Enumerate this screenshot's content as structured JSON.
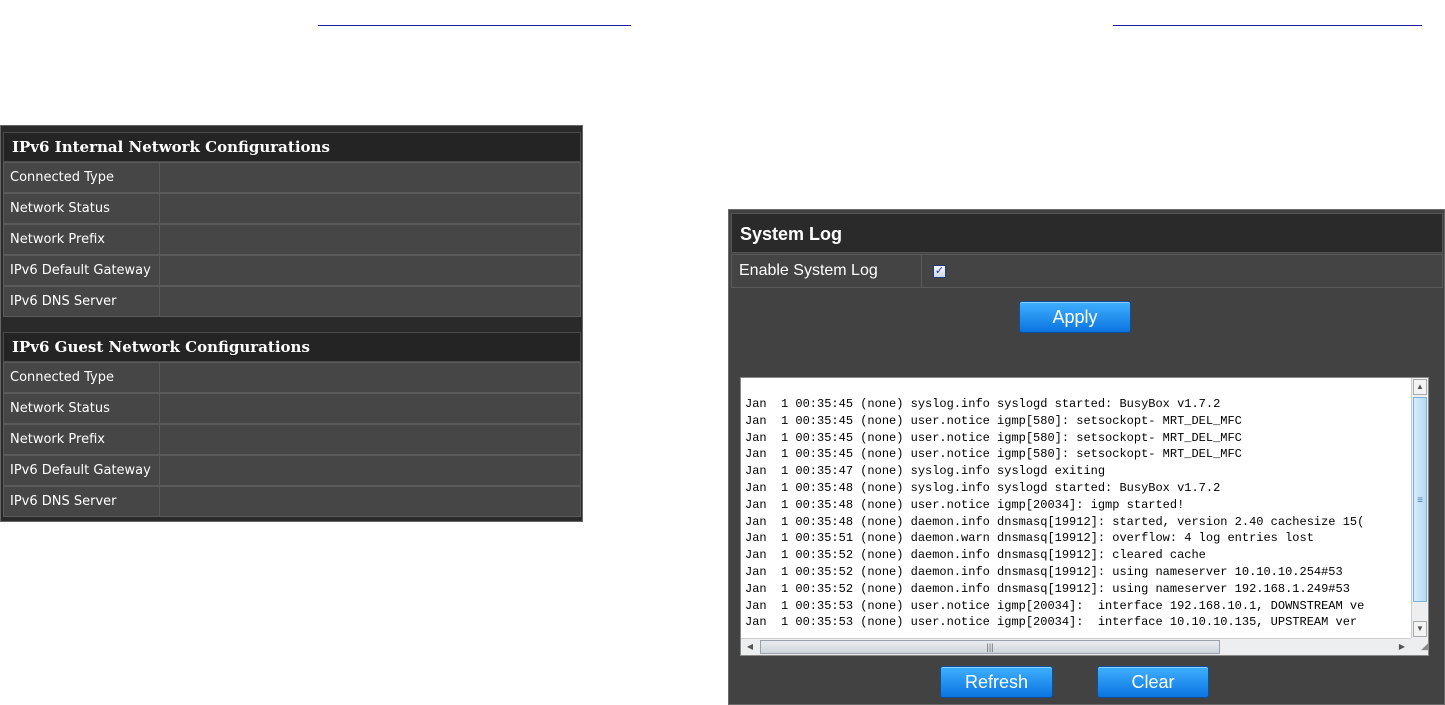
{
  "ipv6_internal": {
    "title": "IPv6 Internal Network Configurations",
    "rows": [
      {
        "label": "Connected Type",
        "value": ""
      },
      {
        "label": "Network Status",
        "value": ""
      },
      {
        "label": "Network Prefix",
        "value": ""
      },
      {
        "label": "IPv6 Default Gateway",
        "value": ""
      },
      {
        "label": "IPv6 DNS Server",
        "value": ""
      }
    ]
  },
  "ipv6_guest": {
    "title": "IPv6 Guest Network Configurations",
    "rows": [
      {
        "label": "Connected Type",
        "value": ""
      },
      {
        "label": "Network Status",
        "value": ""
      },
      {
        "label": "Network Prefix",
        "value": ""
      },
      {
        "label": "IPv6 Default Gateway",
        "value": ""
      },
      {
        "label": "IPv6 DNS Server",
        "value": ""
      }
    ]
  },
  "system_log": {
    "title": "System Log",
    "enable_label": "Enable System Log",
    "enable_checked": true,
    "checkbox_mark": "✓",
    "apply_label": "Apply",
    "refresh_label": "Refresh",
    "clear_label": "Clear",
    "log_lines": [
      "Jan  1 00:35:45 (none) syslog.info syslogd started: BusyBox v1.7.2",
      "Jan  1 00:35:45 (none) user.notice igmp[580]: setsockopt- MRT_DEL_MFC",
      "Jan  1 00:35:45 (none) user.notice igmp[580]: setsockopt- MRT_DEL_MFC",
      "Jan  1 00:35:45 (none) user.notice igmp[580]: setsockopt- MRT_DEL_MFC",
      "Jan  1 00:35:47 (none) syslog.info syslogd exiting",
      "Jan  1 00:35:48 (none) syslog.info syslogd started: BusyBox v1.7.2",
      "Jan  1 00:35:48 (none) user.notice igmp[20034]: igmp started!",
      "Jan  1 00:35:48 (none) daemon.info dnsmasq[19912]: started, version 2.40 cachesize 15(",
      "Jan  1 00:35:51 (none) daemon.warn dnsmasq[19912]: overflow: 4 log entries lost",
      "Jan  1 00:35:52 (none) daemon.info dnsmasq[19912]: cleared cache",
      "Jan  1 00:35:52 (none) daemon.info dnsmasq[19912]: using nameserver 10.10.10.254#53",
      "Jan  1 00:35:52 (none) daemon.info dnsmasq[19912]: using nameserver 192.168.1.249#53",
      "Jan  1 00:35:53 (none) user.notice igmp[20034]:  interface 192.168.10.1, DOWNSTREAM ve",
      "Jan  1 00:35:53 (none) user.notice igmp[20034]:  interface 10.10.10.135, UPSTREAM ver"
    ]
  },
  "colors": {
    "panel_bg": "#2a2a2a",
    "row_bg": "#464646",
    "button_blue": "#1a8cf0",
    "link_rule": "#1a1aa6"
  }
}
